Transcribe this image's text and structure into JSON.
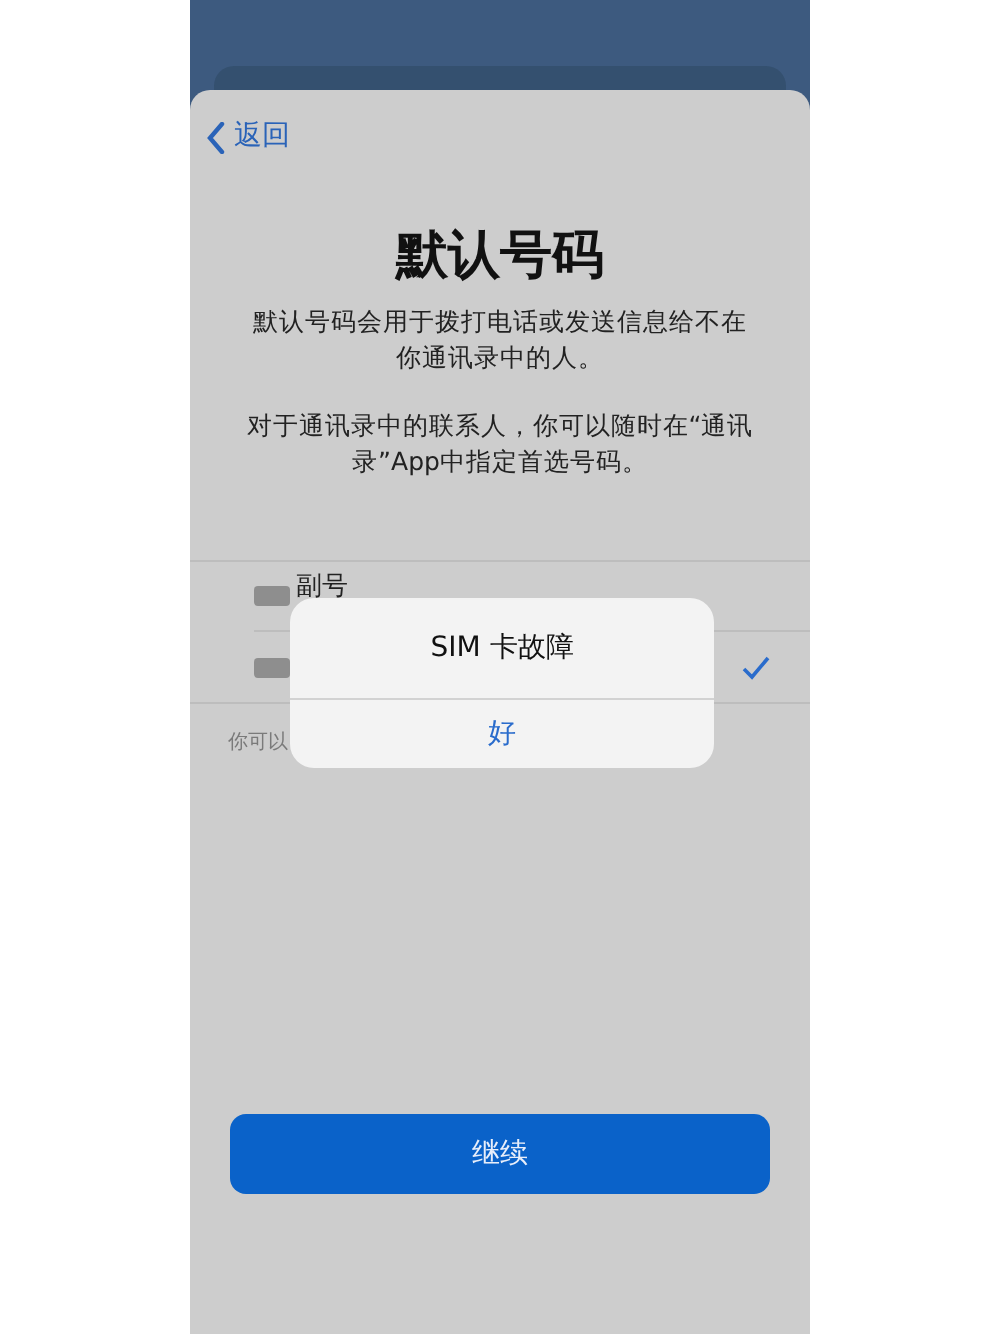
{
  "nav": {
    "back_label": "返回"
  },
  "title": "默认号码",
  "paragraphs": [
    "默认号码会用于拨打电话或发送信息给不在你通讯录中的人。",
    "对于通讯录中的联系人，你可以随时在“通讯录”App中指定首选号码。"
  ],
  "lines": [
    {
      "name": "副号",
      "selected": false
    },
    {
      "selected": true
    }
  ],
  "footnote": "你可以",
  "alert": {
    "title": "SIM 卡故障",
    "button": "好"
  },
  "continue_button": "继续"
}
